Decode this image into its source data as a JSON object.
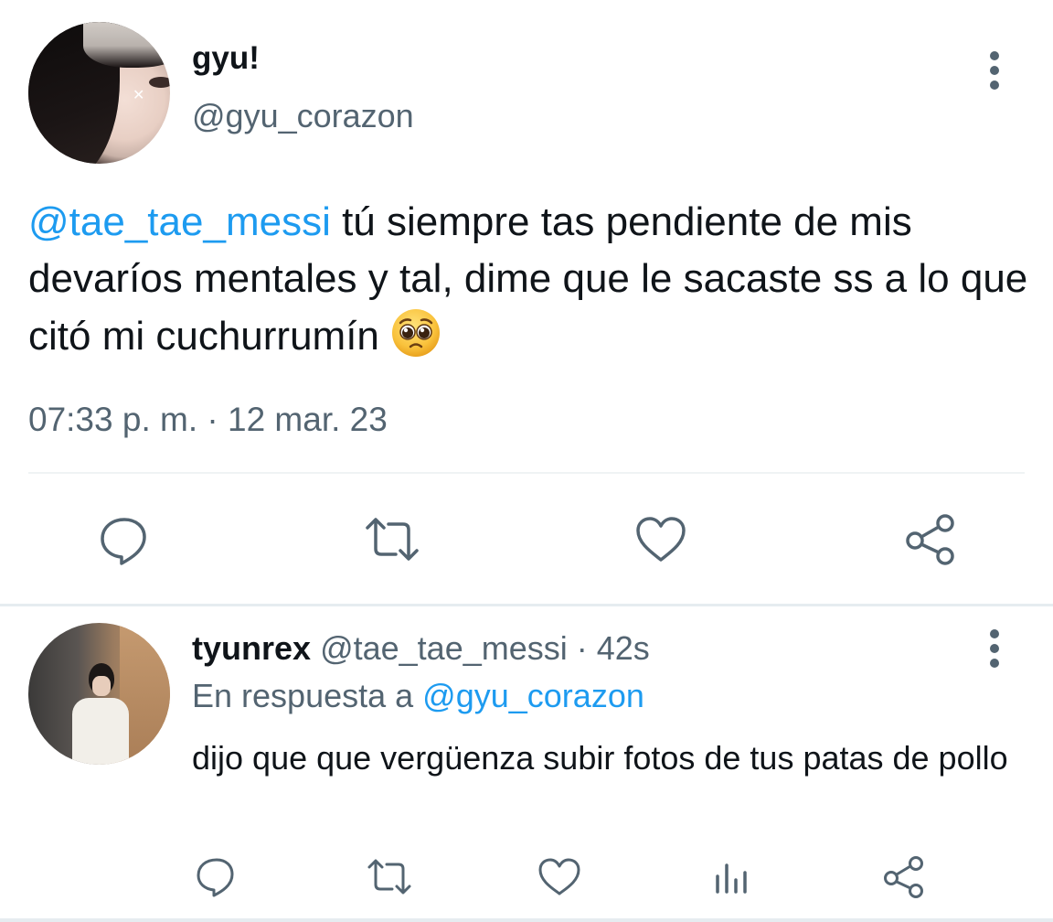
{
  "main_tweet": {
    "display_name": "gyu!",
    "handle": "@gyu_corazon",
    "mention": "@tae_tae_messi",
    "text": " tú siempre tas pendiente de mis devaríos mentales y tal, dime que le sacaste ss a lo que citó mi cuchurrumín ",
    "emoji": "pleading-face-emoji",
    "timestamp": "07:33 p. m. · 12 mar. 23",
    "actions": [
      "reply-icon",
      "retweet-icon",
      "like-icon",
      "share-icon"
    ]
  },
  "reply": {
    "display_name": "tyunrex",
    "handle": "@tae_tae_messi",
    "separator": " · ",
    "age": "42s",
    "reply_to_prefix": "En respuesta a ",
    "reply_to_handle": "@gyu_corazon",
    "text": "dijo que que vergüenza subir fotos de tus patas de pollo",
    "actions": [
      "reply-icon",
      "retweet-icon",
      "like-icon",
      "analytics-icon",
      "share-icon"
    ]
  },
  "colors": {
    "text_primary": "#0f1419",
    "text_secondary": "#536471",
    "accent": "#1d9bf0",
    "divider": "#eff3f4"
  }
}
